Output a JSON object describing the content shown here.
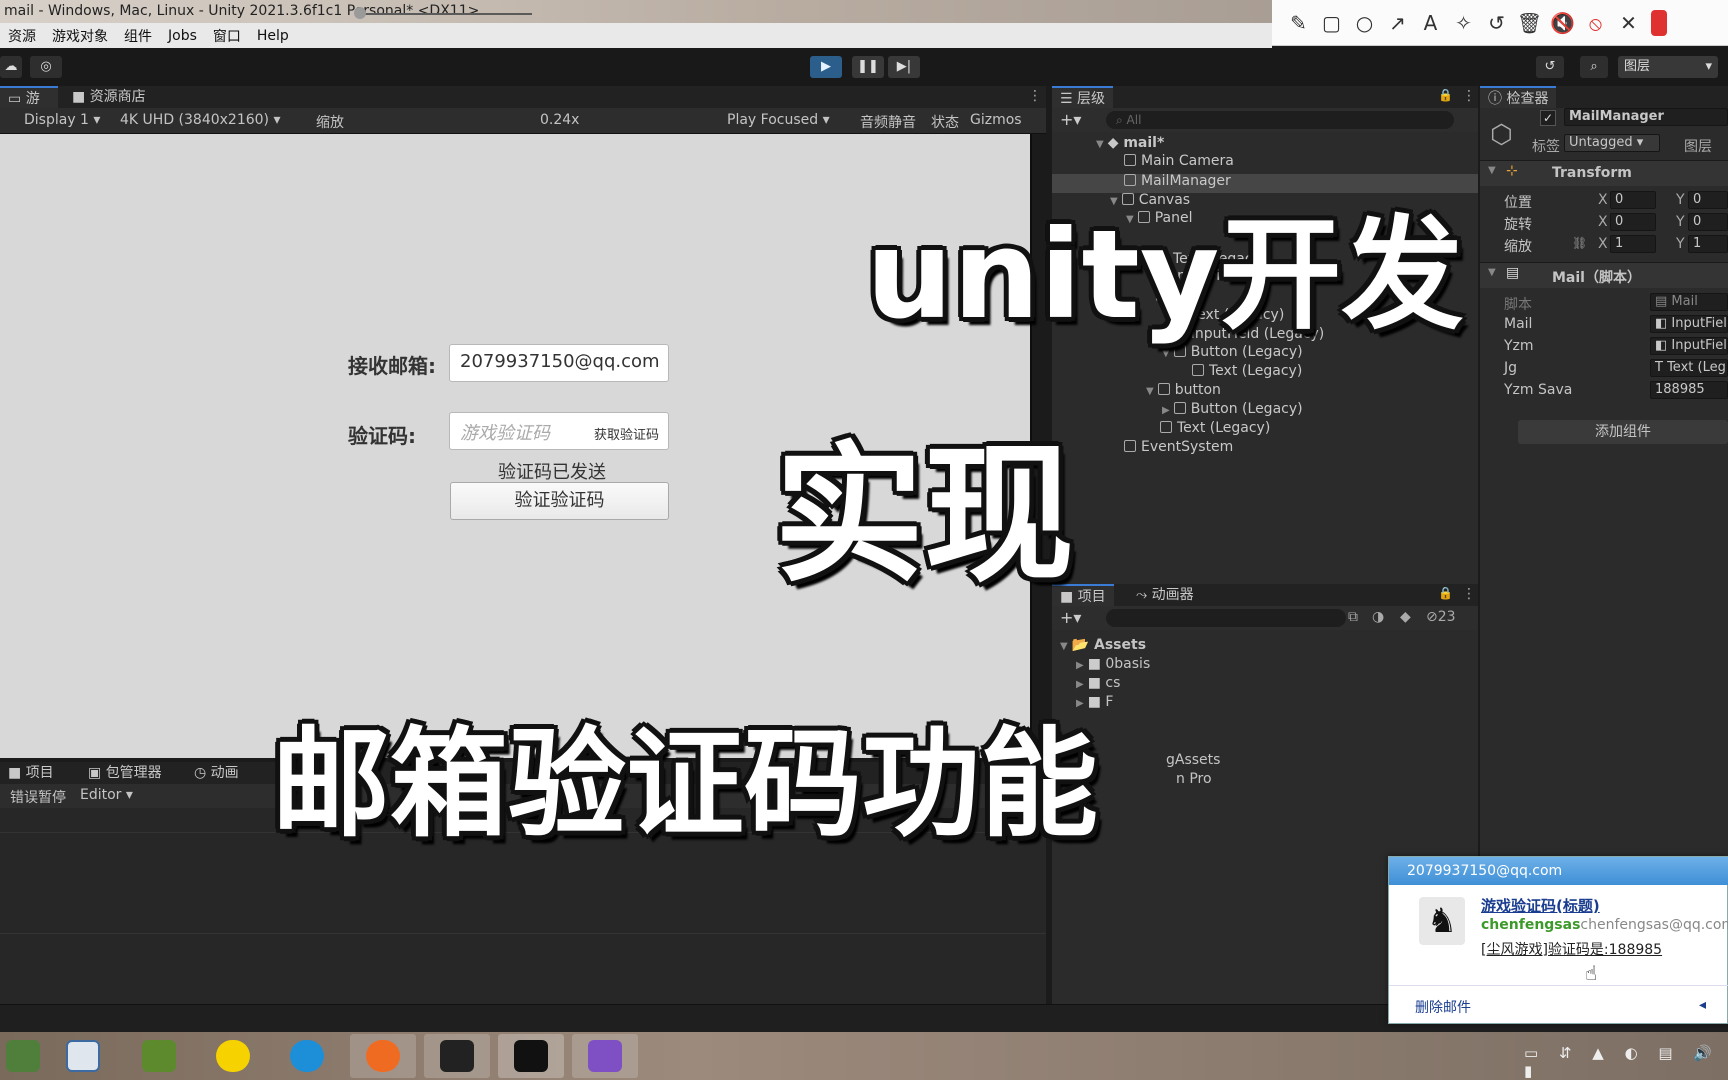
{
  "window": {
    "title": "mail - Windows, Mac, Linux - Unity 2021.3.6f1c1 Personal* <DX11>"
  },
  "menu": [
    "资源",
    "游戏对象",
    "组件",
    "Jobs",
    "窗口",
    "Help"
  ],
  "toolbar": {
    "layers_label": "图层"
  },
  "game_panel": {
    "tabs": [
      "游戏",
      "资源商店"
    ],
    "display": "Display 1",
    "resolution": "4K UHD (3840x2160)",
    "zoom_label": "缩放",
    "zoom_value": "0.24x",
    "zoom_fraction": 0.02,
    "play_focused": "Play Focused",
    "mute_audio": "音频静音",
    "stats": "状态",
    "gizmos": "Gizmos"
  },
  "game_view": {
    "email_label": "接收邮箱:",
    "email_value": "2079937150@qq.com",
    "code_label": "验证码:",
    "code_placeholder": "游戏验证码",
    "get_code_button": "获取验证码",
    "status_text": "验证码已发送",
    "verify_button": "验证验证码"
  },
  "hierarchy": {
    "tab": "层级",
    "search_placeholder": "All",
    "items": [
      {
        "label": "mail*",
        "depth": 0
      },
      {
        "label": "Main Camera",
        "depth": 1
      },
      {
        "label": "MailManager",
        "depth": 1
      },
      {
        "label": "Canvas",
        "depth": 1
      },
      {
        "label": "Panel",
        "depth": 2
      },
      {
        "label": "Text (Legacy)",
        "depth": 3
      },
      {
        "label": "InputField (Legacy)",
        "depth": 3
      },
      {
        "label": "n",
        "depth": 3
      },
      {
        "label": "Text (Legacy)",
        "depth": 4
      },
      {
        "label": "InputField (Legacy)",
        "depth": 4
      },
      {
        "label": "Button (Legacy)",
        "depth": 4
      },
      {
        "label": "Text (Legacy)",
        "depth": 5
      },
      {
        "label": "button",
        "depth": 3
      },
      {
        "label": "Button (Legacy)",
        "depth": 4
      },
      {
        "label": "Text (Legacy)",
        "depth": 3
      },
      {
        "label": "EventSystem",
        "depth": 1
      }
    ]
  },
  "inspector": {
    "tab": "检查器",
    "object_name": "MailManager",
    "tag_label": "标签",
    "tag_value": "Untagged",
    "layer_label": "图层",
    "transform_title": "Transform",
    "position_label": "位置",
    "rotation_label": "旋转",
    "scale_label": "缩放",
    "axis_x": "X",
    "axis_y": "Y",
    "pos_x": "0",
    "pos_y": "0",
    "rot_x": "0",
    "rot_y": "0",
    "scl_x": "1",
    "scl_y": "1",
    "script_title": "Mail（脚本）",
    "script_label": "脚本",
    "script_value": "Mail",
    "fields": [
      {
        "label": "Mail",
        "value": "InputFiel"
      },
      {
        "label": "Yzm",
        "value": "InputFiel"
      },
      {
        "label": "Jg",
        "value": "Text (Leg"
      },
      {
        "label": "Yzm Sava",
        "value": "188985"
      }
    ],
    "add_component": "添加组件"
  },
  "project": {
    "tabs": [
      "项目",
      "动画器"
    ],
    "hidden_count": "23",
    "tree": [
      {
        "label": "Assets",
        "depth": 0
      },
      {
        "label": "0basis",
        "depth": 1
      },
      {
        "label": "cs",
        "depth": 1
      },
      {
        "label": "F",
        "depth": 1
      },
      {
        "label": "gAssets",
        "depth": 1
      },
      {
        "label": "n Pro",
        "depth": 1
      }
    ]
  },
  "console": {
    "tabs": [
      "项目",
      "包管理器",
      "动画"
    ],
    "error_pause": "错误暂停",
    "editor": "Editor"
  },
  "notification": {
    "account": "2079937150@qq.com",
    "subject": "游戏验证码(标题)",
    "sender_name": "chenfengsas",
    "sender_email": "chenfengsas@qq.com",
    "preview": "[尘风游戏]验证码是:188985",
    "delete": "删除邮件"
  },
  "overlay": {
    "line1": "unity开发",
    "line2": "实现",
    "line3": "邮箱验证码功能"
  },
  "colors": {
    "accent": "#3a7bd5",
    "panel": "#2b2b2b",
    "game_bg": "#d8d8d8",
    "notif_header": "#3f8fd6"
  }
}
